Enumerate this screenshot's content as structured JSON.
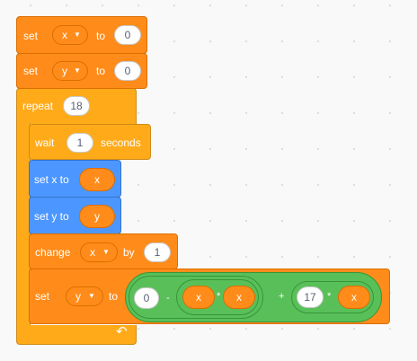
{
  "blocks": {
    "set_x": {
      "keyword": "set",
      "variable": "x",
      "to": "to",
      "value": "0"
    },
    "set_y": {
      "keyword": "set",
      "variable": "y",
      "to": "to",
      "value": "0"
    },
    "repeat": {
      "keyword": "repeat",
      "count": "18",
      "loop_icon": "rotate-arrow-icon"
    },
    "wait": {
      "keyword": "wait",
      "value": "1",
      "unit": "seconds"
    },
    "set_x_to": {
      "label": "set x to",
      "reporter": "x"
    },
    "set_y_to": {
      "label": "set y to",
      "reporter": "y"
    },
    "change": {
      "keyword": "change",
      "variable": "x",
      "by": "by",
      "value": "1"
    },
    "set_y_expr": {
      "keyword": "set",
      "variable": "y",
      "to": "to",
      "expr": {
        "zero": "0",
        "minus": "-",
        "x1": "x",
        "times1": "*",
        "x2": "x",
        "plus": "+",
        "seventeen": "17",
        "times2": "*",
        "x3": "x"
      }
    }
  },
  "colors": {
    "variables": "#FF8C1A",
    "control": "#FFAB19",
    "motion": "#4C97FF",
    "operators": "#59C059",
    "workspace": "#F9F9F9"
  }
}
